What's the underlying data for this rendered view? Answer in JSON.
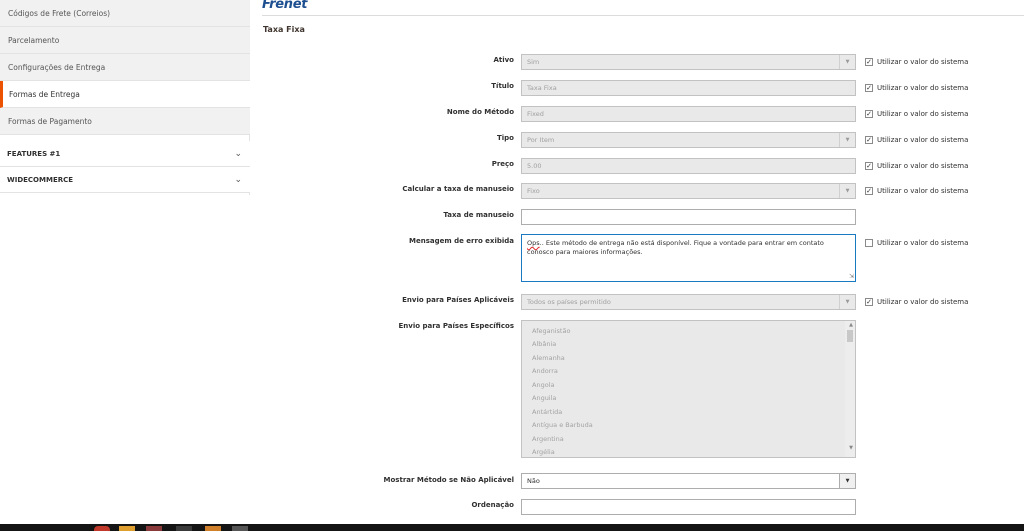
{
  "sidebar": {
    "items": [
      {
        "label": "Códigos de Frete (Correios)"
      },
      {
        "label": "Parcelamento"
      },
      {
        "label": "Configurações de Entrega"
      },
      {
        "label": "Formas de Entrega"
      },
      {
        "label": "Formas de Pagamento"
      }
    ],
    "groups": [
      {
        "label": "FEATURES #1"
      },
      {
        "label": "WIDECOMMERCE"
      }
    ]
  },
  "header": {
    "brand": "Frenet"
  },
  "section": {
    "title": "Taxa Fixa"
  },
  "system_value_label": "Utilizar o valor do sistema",
  "fields": {
    "ativo": {
      "label": "Ativo",
      "value": "Sim"
    },
    "titulo": {
      "label": "Título",
      "value": "Taxa Fixa"
    },
    "nome_metodo": {
      "label": "Nome do Método",
      "value": "Fixed"
    },
    "tipo": {
      "label": "Tipo",
      "value": "Por Item"
    },
    "preco": {
      "label": "Preço",
      "value": "5.00"
    },
    "calcular_taxa": {
      "label": "Calcular a taxa de manuseio",
      "value": "Fixo"
    },
    "taxa_manuseio": {
      "label": "Taxa de manuseio",
      "value": ""
    },
    "mensagem_erro": {
      "label": "Mensagem de erro exibida",
      "value_prefix": "Ops",
      "value_rest": ".. Este método de entrega não está disponível. Fique a vontade para entrar em contato conosco para maiores informações."
    },
    "envio_aplicaveis": {
      "label": "Envio para Países Aplicáveis",
      "value": "Todos os países permitido"
    },
    "envio_especificos": {
      "label": "Envio para Países Específicos",
      "options": [
        "Afeganistão",
        "Albânia",
        "Alemanha",
        "Andorra",
        "Angola",
        "Anguila",
        "Antártida",
        "Antígua e Barbuda",
        "Argentina",
        "Argélia"
      ]
    },
    "mostrar_metodo": {
      "label": "Mostrar Método se Não Aplicável",
      "value": "Não"
    },
    "ordenacao": {
      "label": "Ordenação",
      "value": ""
    }
  },
  "colors": {
    "accent": "#eb5202",
    "brand": "#1d4f91",
    "focus": "#1979c3"
  }
}
